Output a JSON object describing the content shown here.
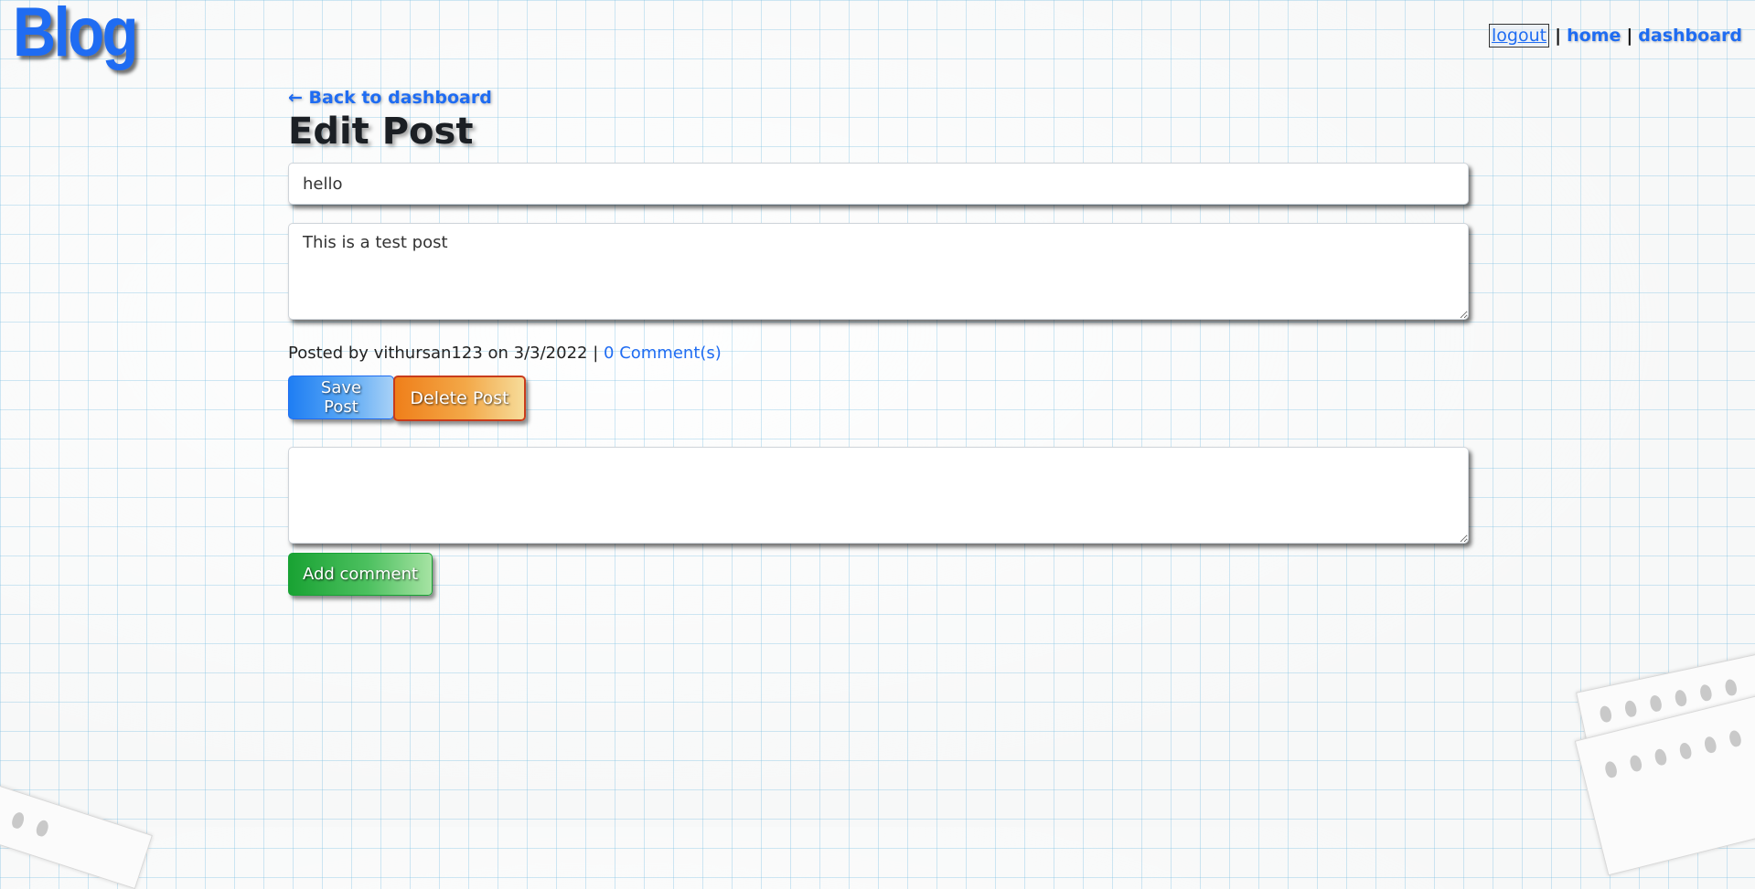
{
  "header": {
    "logo": "Blog",
    "nav": {
      "logout": "logout",
      "separator": "|",
      "home": "home",
      "dashboard": "dashboard"
    }
  },
  "main": {
    "back_link": "← Back to dashboard",
    "page_title": "Edit Post",
    "post_title_value": "hello",
    "post_body_value": "This is a test post",
    "meta_prefix": "Posted by vithursan123 on 3/3/2022 |",
    "comments_link": "0 Comment(s)",
    "save_label": "Save Post",
    "delete_label": "Delete Post",
    "comment_value": "",
    "add_comment_label": "Add comment"
  },
  "colors": {
    "accent": "#1f6cf2",
    "save": "#1f7ef3",
    "delete": "#ef7f1a",
    "add": "#19a233"
  }
}
